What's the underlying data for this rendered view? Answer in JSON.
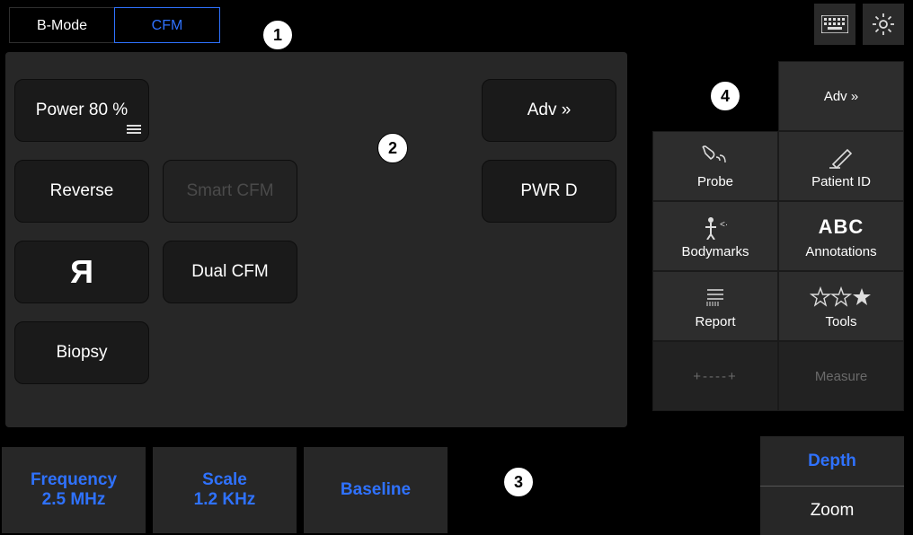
{
  "tabs": {
    "bmode": "B-Mode",
    "cfm": "CFM"
  },
  "topicons": {
    "keyboard": "keyboard-icon",
    "settings": "gear-icon"
  },
  "panel": {
    "power": "Power 80 %",
    "reverse": "Reverse",
    "mirror_glyph": "Я",
    "biopsy": "Biopsy",
    "smart_cfm": "Smart CFM",
    "dual_cfm": "Dual CFM",
    "adv": "Adv »",
    "pwr_d": "PWR D"
  },
  "params": {
    "frequency_label": "Frequency",
    "frequency_value": "2.5 MHz",
    "scale_label": "Scale",
    "scale_value": "1.2 KHz",
    "baseline": "Baseline"
  },
  "right": {
    "adv": "Adv »",
    "probe": "Probe",
    "patient_id": "Patient ID",
    "bodymarks": "Bodymarks",
    "annotations": "Annotations",
    "report": "Report",
    "tools": "Tools",
    "measure_glyph": "+----+",
    "measure": "Measure"
  },
  "dz": {
    "depth": "Depth",
    "zoom": "Zoom"
  },
  "callouts": {
    "c1": "1",
    "c2": "2",
    "c3": "3",
    "c4": "4"
  }
}
